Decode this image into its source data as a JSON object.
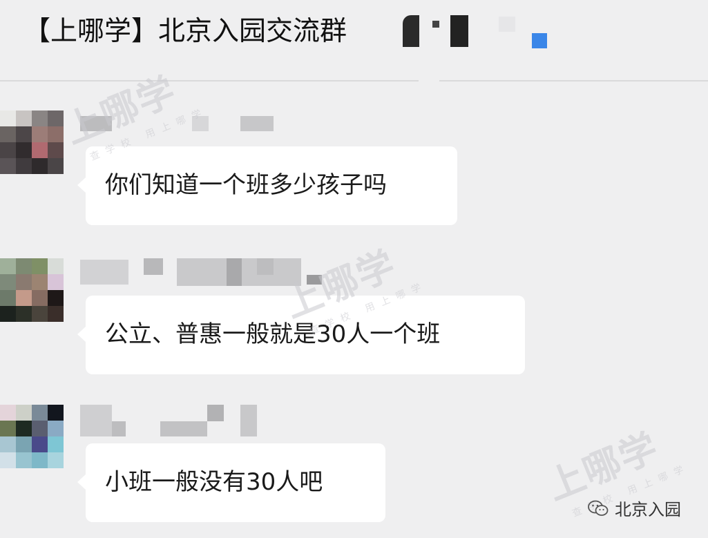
{
  "header": {
    "title": "【上哪学】北京入园交流群",
    "blue_indicator_color": "#3a86e8"
  },
  "messages": [
    {
      "text": "你们知道一个班多少孩子吗"
    },
    {
      "text": "公立、普惠一般就是30人一个班"
    },
    {
      "text": "小班一般没有30人吧"
    }
  ],
  "watermark": {
    "main": "上哪学",
    "sub": "查学校 用上哪学"
  },
  "footer": {
    "icon": "wechat-icon",
    "label": "北京入园"
  },
  "colors": {
    "background": "#efeff0",
    "bubble": "#ffffff",
    "text": "#1a1a1a"
  }
}
